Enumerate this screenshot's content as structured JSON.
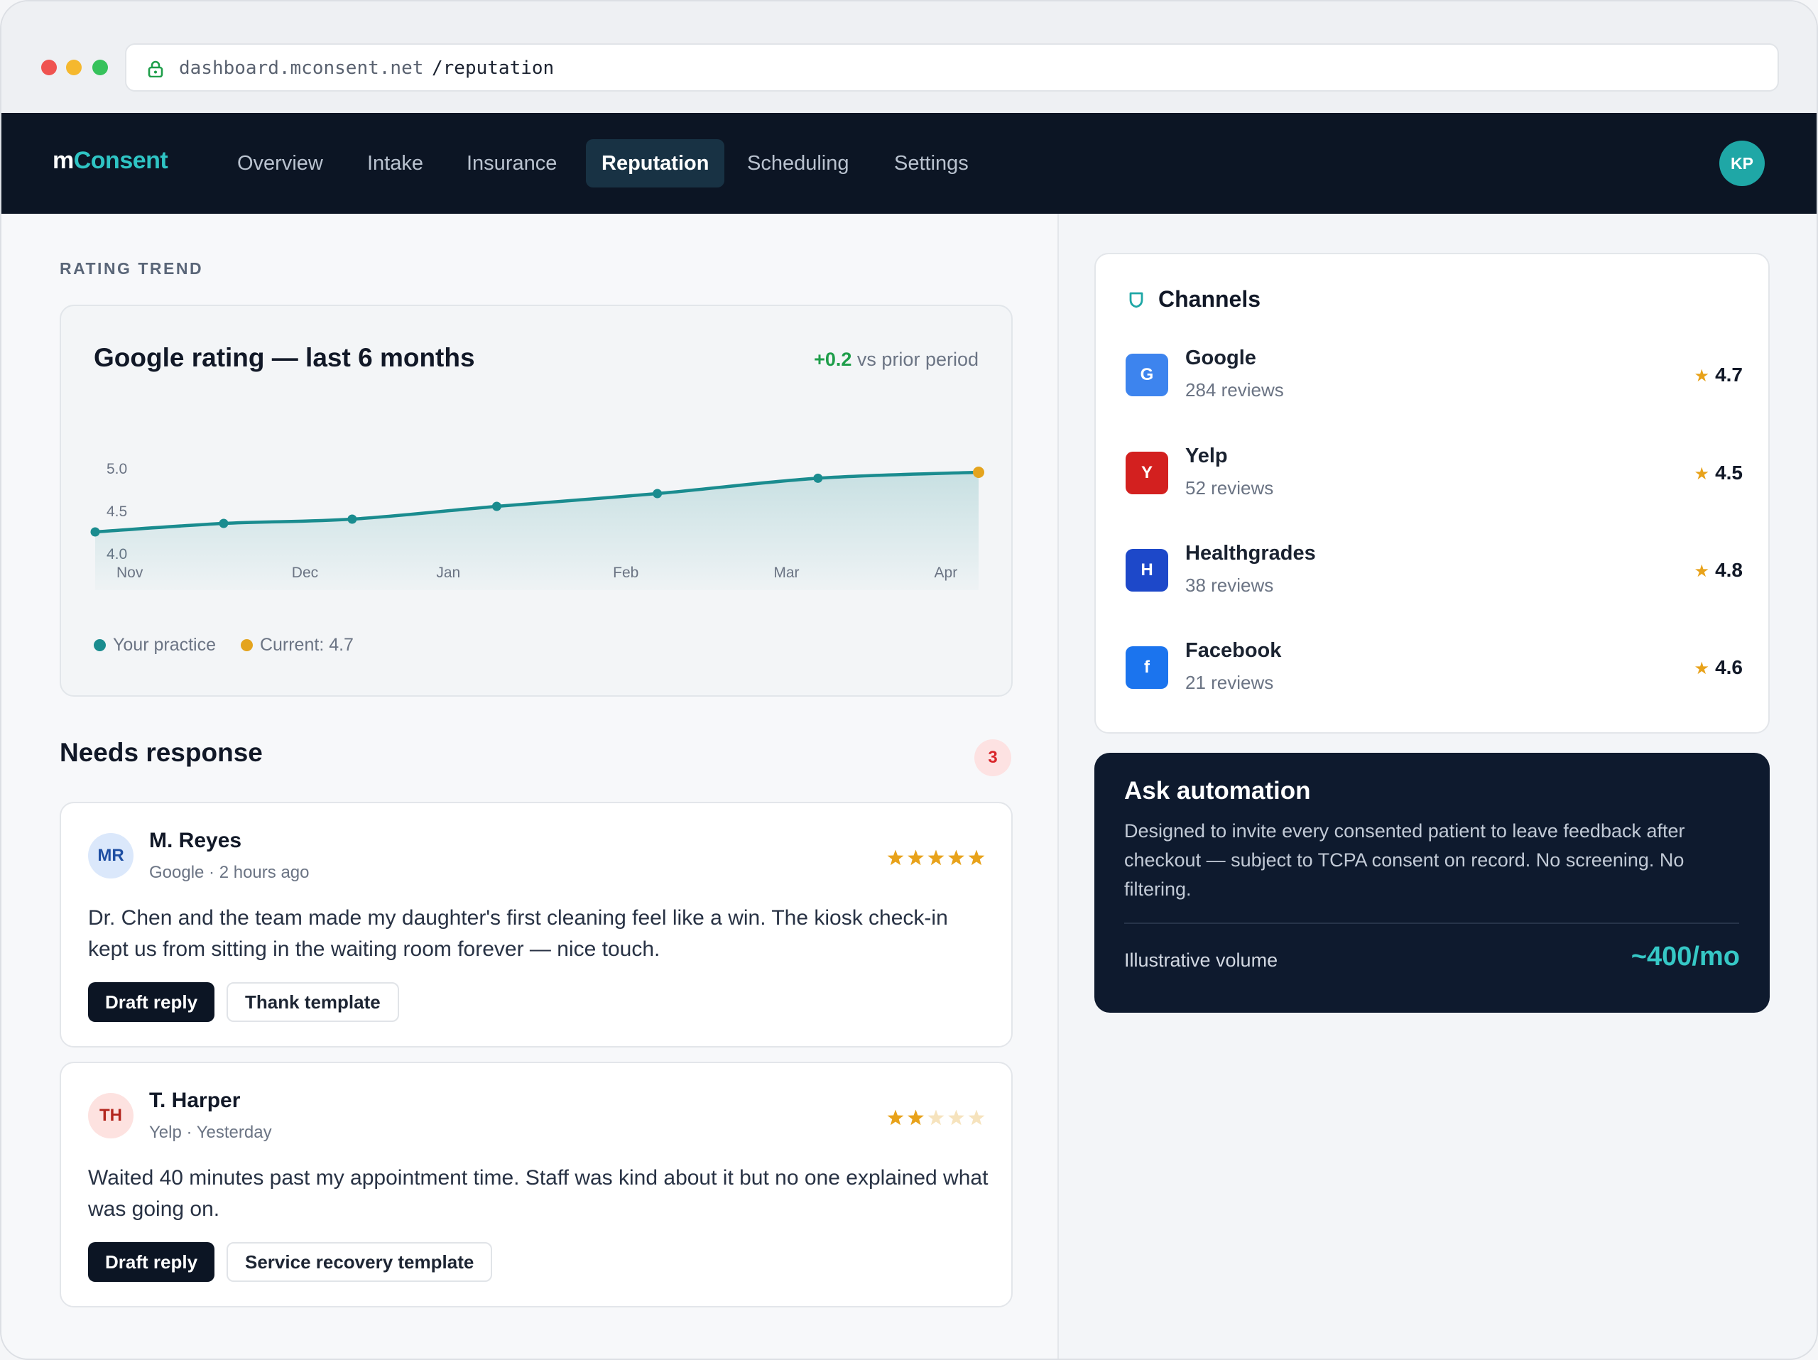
{
  "browser": {
    "url_host": "dashboard.mconsent.net",
    "url_path": "/reputation"
  },
  "nav": {
    "brand_part1": "m",
    "brand_part2": "Consent",
    "tabs": [
      {
        "label": "Overview"
      },
      {
        "label": "Intake"
      },
      {
        "label": "Insurance"
      },
      {
        "label": "Reputation",
        "active": true
      },
      {
        "label": "Scheduling"
      },
      {
        "label": "Settings"
      }
    ],
    "user_initials": "KP"
  },
  "trend": {
    "section_label": "RATING TREND",
    "title": "Google rating — last 6 months",
    "delta_value": "+0.2",
    "delta_text": "vs prior period",
    "legend": [
      {
        "label": "Your practice",
        "color": "#1a8c8f"
      },
      {
        "label": "Current: 4.7",
        "color": "#e4a41e"
      }
    ]
  },
  "chart_data": {
    "type": "area",
    "title": "Google rating — last 6 months",
    "xlabel": "",
    "ylabel": "",
    "categories": [
      "Nov",
      "Dec",
      "Jan",
      "Feb",
      "Mar",
      "Apr"
    ],
    "y_ticks": [
      "5.0",
      "4.5",
      "4.0"
    ],
    "ylim": [
      4.0,
      5.0
    ],
    "grid": false,
    "series": [
      {
        "name": "Your practice",
        "color": "#1a8c8f",
        "x": [
          0.0,
          0.8,
          1.6,
          2.5,
          3.5,
          4.5,
          5.5
        ],
        "values": [
          4.25,
          4.35,
          4.4,
          4.55,
          4.7,
          4.88,
          4.95
        ]
      }
    ],
    "current_marker": {
      "x": 5.5,
      "value": 4.95,
      "color": "#e4a41e"
    }
  },
  "needs": {
    "title": "Needs response",
    "count": "3"
  },
  "reviews": [
    {
      "initials": "MR",
      "name": "M. Reyes",
      "meta": "Google · 2 hours ago",
      "stars": 5,
      "text": "Dr. Chen and the team made my daughter's first cleaning feel like a win. The kiosk check-in kept us from sitting in the waiting room forever — nice touch.",
      "primary": "Draft reply",
      "secondary": "Thank template",
      "avatar_bg": "#dbe8fb",
      "avatar_fg": "#1f4fa3"
    },
    {
      "initials": "TH",
      "name": "T. Harper",
      "meta": "Yelp · Yesterday",
      "stars": 2,
      "text": "Waited 40 minutes past my appointment time. Staff was kind about it but no one explained what was going on.",
      "primary": "Draft reply",
      "secondary": "Service recovery template",
      "avatar_bg": "#fde2e0",
      "avatar_fg": "#b3261e"
    }
  ],
  "channels": {
    "title": "Channels",
    "items": [
      {
        "logo": "G",
        "name": "Google",
        "count": "284 reviews",
        "rating": "4.7",
        "color": "#3d84ee"
      },
      {
        "logo": "Y",
        "name": "Yelp",
        "count": "52 reviews",
        "rating": "4.5",
        "color": "#d3201f"
      },
      {
        "logo": "H",
        "name": "Healthgrades",
        "count": "38 reviews",
        "rating": "4.8",
        "color": "#1d48c9"
      },
      {
        "logo": "f",
        "name": "Facebook",
        "count": "21 reviews",
        "rating": "4.6",
        "color": "#1b74ee"
      }
    ]
  },
  "ask": {
    "title": "Ask automation",
    "description": "Designed to invite every consented patient to leave feedback after checkout — subject to TCPA consent on record. No screening. No filtering.",
    "volume_label": "Illustrative volume",
    "volume_value": "~400/mo"
  },
  "colors": {
    "accent": "#2fc4c4",
    "nav_bg": "#0c1524",
    "star": "#e8a21a"
  }
}
